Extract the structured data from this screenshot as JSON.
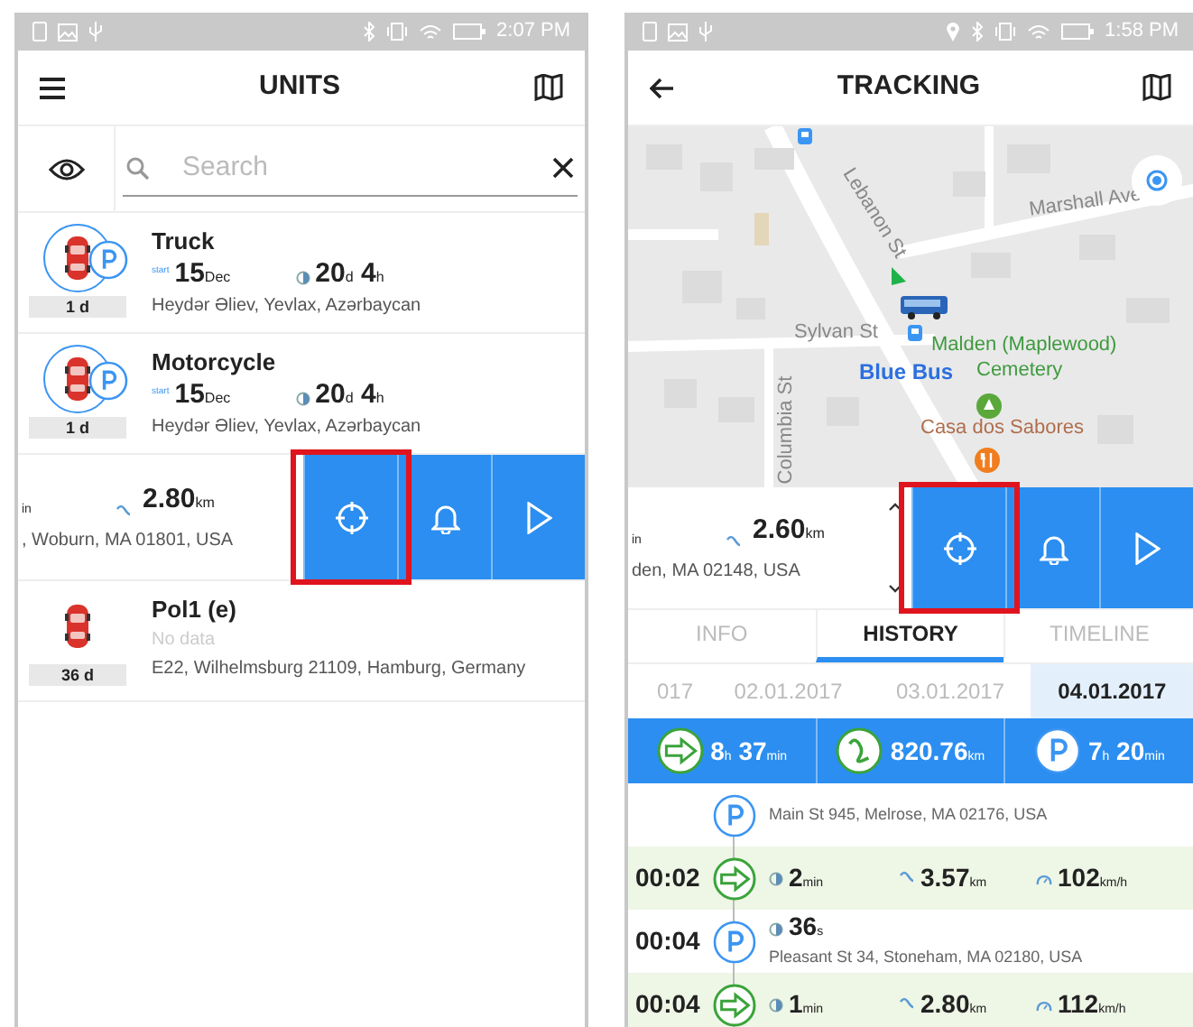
{
  "units_screen": {
    "status_bar": {
      "time": "2:07 PM",
      "location_indicator": false
    },
    "header": {
      "title": "UNITS"
    },
    "search": {
      "placeholder": "Search"
    },
    "units": [
      {
        "kind": "unit",
        "name": "Truck",
        "parked": true,
        "badge": "1 d",
        "start_label": "start",
        "start": {
          "value": "15",
          "unit": "Dec"
        },
        "duration": [
          {
            "value": "20",
            "unit": "d"
          },
          {
            "value": "4",
            "unit": "h"
          }
        ],
        "address": "Heydər Əliev, Yevlax, Azərbaycan"
      },
      {
        "kind": "unit",
        "name": "Motorcycle",
        "parked": true,
        "badge": "1 d",
        "start_label": "start",
        "start": {
          "value": "15",
          "unit": "Dec"
        },
        "duration": [
          {
            "value": "20",
            "unit": "d"
          },
          {
            "value": "4",
            "unit": "h"
          }
        ],
        "address": "Heydər Əliev, Yevlax, Azərbaycan"
      },
      {
        "kind": "swiped",
        "fragment": "in",
        "distance": {
          "value": "2.80",
          "unit": "km"
        },
        "address": ", Woburn, MA 01801, USA",
        "actions": [
          {
            "kind": "locate",
            "highlighted": true
          },
          {
            "kind": "alarm",
            "highlighted": false
          },
          {
            "kind": "play",
            "highlighted": false
          }
        ]
      },
      {
        "kind": "unit",
        "name": "Pol1 (e)",
        "parked": false,
        "badge": "36 d",
        "no_data": "No data",
        "address": "E22, Wilhelmsburg 21109, Hamburg, Germany"
      }
    ]
  },
  "tracking_screen": {
    "status_bar": {
      "time": "1:58 PM",
      "location_indicator": true
    },
    "header": {
      "title": "TRACKING"
    },
    "map": {
      "labels": [
        {
          "text": "Marshall Ave",
          "kind": "street"
        },
        {
          "text": "Lebanon St",
          "kind": "street"
        },
        {
          "text": "Sylvan St",
          "kind": "street"
        },
        {
          "text": "Malden (Maplewood)",
          "kind": "park"
        },
        {
          "text": "Cemetery",
          "kind": "park"
        },
        {
          "text": "Blue Bus",
          "kind": "unit"
        },
        {
          "text": "Casa dos Sabores",
          "kind": "restaurant"
        },
        {
          "text": "Columbia St",
          "kind": "street"
        }
      ]
    },
    "unit_panel": {
      "fragment": "in",
      "distance": {
        "value": "2.60",
        "unit": "km"
      },
      "address": "den, MA 02148, USA"
    },
    "actions": [
      {
        "kind": "locate",
        "highlighted": true
      },
      {
        "kind": "alarm",
        "highlighted": false
      },
      {
        "kind": "play",
        "highlighted": false
      }
    ],
    "tabs": [
      {
        "label": "INFO",
        "selected": false
      },
      {
        "label": "HISTORY",
        "selected": true
      },
      {
        "label": "TIMELINE",
        "selected": false
      }
    ],
    "dates": [
      {
        "label": "017",
        "selected": false
      },
      {
        "label": "02.01.2017",
        "selected": false
      },
      {
        "label": "03.01.2017",
        "selected": false
      },
      {
        "label": "04.01.2017",
        "selected": true
      }
    ],
    "summary": [
      {
        "kind": "trip",
        "parts": [
          {
            "value": "8",
            "unit": "h"
          },
          {
            "value": "37",
            "unit": "min"
          }
        ]
      },
      {
        "kind": "distance",
        "parts": [
          {
            "value": "820.76",
            "unit": "km"
          }
        ]
      },
      {
        "kind": "parking",
        "parts": [
          {
            "value": "7",
            "unit": "h"
          },
          {
            "value": "20",
            "unit": "min"
          }
        ]
      }
    ],
    "history": [
      {
        "kind": "parking",
        "address": "Main St 945, Melrose, MA 02176, USA"
      },
      {
        "kind": "trip",
        "time": "00:02",
        "duration": {
          "value": "2",
          "unit": "min"
        },
        "distance": {
          "value": "3.57",
          "unit": "km"
        },
        "speed": {
          "value": "102",
          "unit": "km/h"
        }
      },
      {
        "kind": "parking",
        "time": "00:04",
        "duration": {
          "value": "36",
          "unit": "s"
        },
        "address": "Pleasant St 34, Stoneham, MA 02180, USA"
      },
      {
        "kind": "trip",
        "time": "00:04",
        "duration": {
          "value": "1",
          "unit": "min"
        },
        "distance": {
          "value": "2.80",
          "unit": "km"
        },
        "speed": {
          "value": "112",
          "unit": "km/h"
        }
      }
    ]
  }
}
